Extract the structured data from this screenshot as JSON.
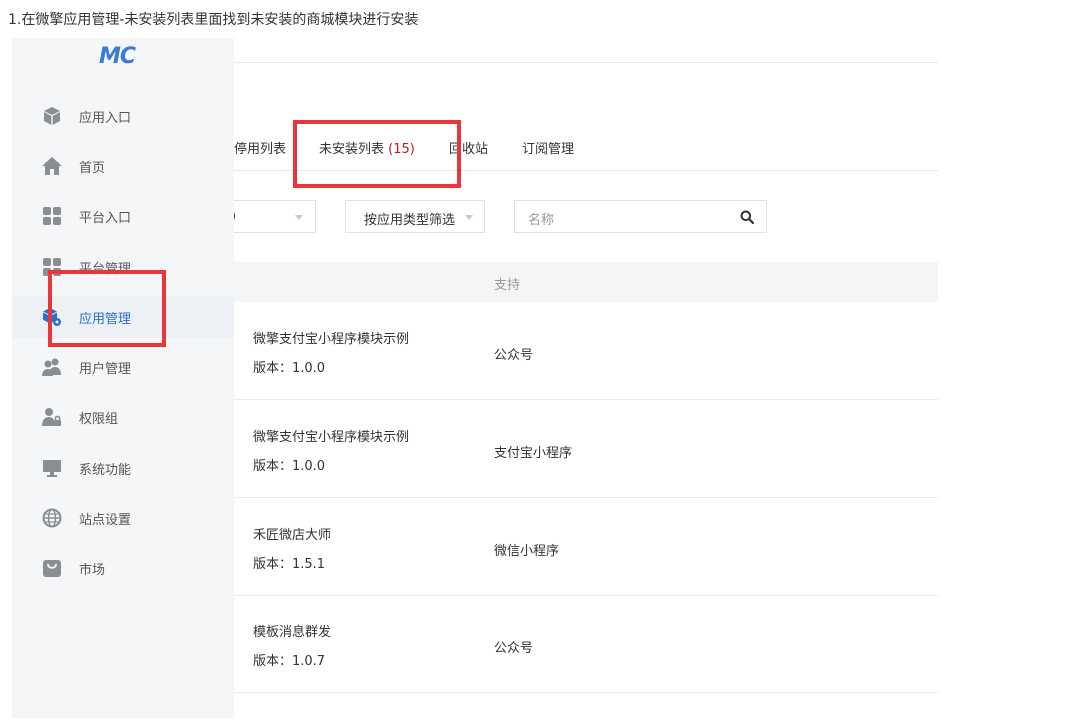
{
  "caption": "1.在微擎应用管理-未安装列表里面找到未安装的商城模块进行安装",
  "logo": "MC",
  "tabs": [
    {
      "label": "停用列表"
    },
    {
      "label": "未安装列表",
      "count": "(15)"
    },
    {
      "label": "回收站"
    },
    {
      "label": "订阅管理"
    }
  ],
  "filters": {
    "first_partial": ")",
    "type_filter": "按应用类型筛选",
    "search_placeholder": "名称"
  },
  "table": {
    "support_header": "支持",
    "rows": [
      {
        "name": "微擎支付宝小程序模块示例",
        "version": "版本：1.0.0",
        "support": "公众号"
      },
      {
        "name": "微擎支付宝小程序模块示例",
        "version": "版本：1.0.0",
        "support": "支付宝小程序"
      },
      {
        "name": "禾匠微店大师",
        "version": "版本：1.5.1",
        "support": "微信小程序"
      },
      {
        "name": "模板消息群发",
        "version": "版本：1.0.7",
        "support": "公众号"
      }
    ]
  },
  "sidebar": {
    "items": [
      {
        "label": "应用入口",
        "icon": "cube-icon"
      },
      {
        "label": "首页",
        "icon": "home-icon"
      },
      {
        "label": "平台入口",
        "icon": "grid-icon"
      },
      {
        "label": "平台管理",
        "icon": "grid-icon"
      },
      {
        "label": "应用管理",
        "icon": "app-settings-icon",
        "active": true
      },
      {
        "label": "用户管理",
        "icon": "users-icon"
      },
      {
        "label": "权限组",
        "icon": "user-lock-icon"
      },
      {
        "label": "系统功能",
        "icon": "monitor-icon"
      },
      {
        "label": "站点设置",
        "icon": "globe-icon"
      },
      {
        "label": "市场",
        "icon": "shopping-bag-icon"
      }
    ]
  },
  "colors": {
    "accent": "#2b6fd6",
    "highlight_box": "#e8373a",
    "count": "#c8161d"
  }
}
